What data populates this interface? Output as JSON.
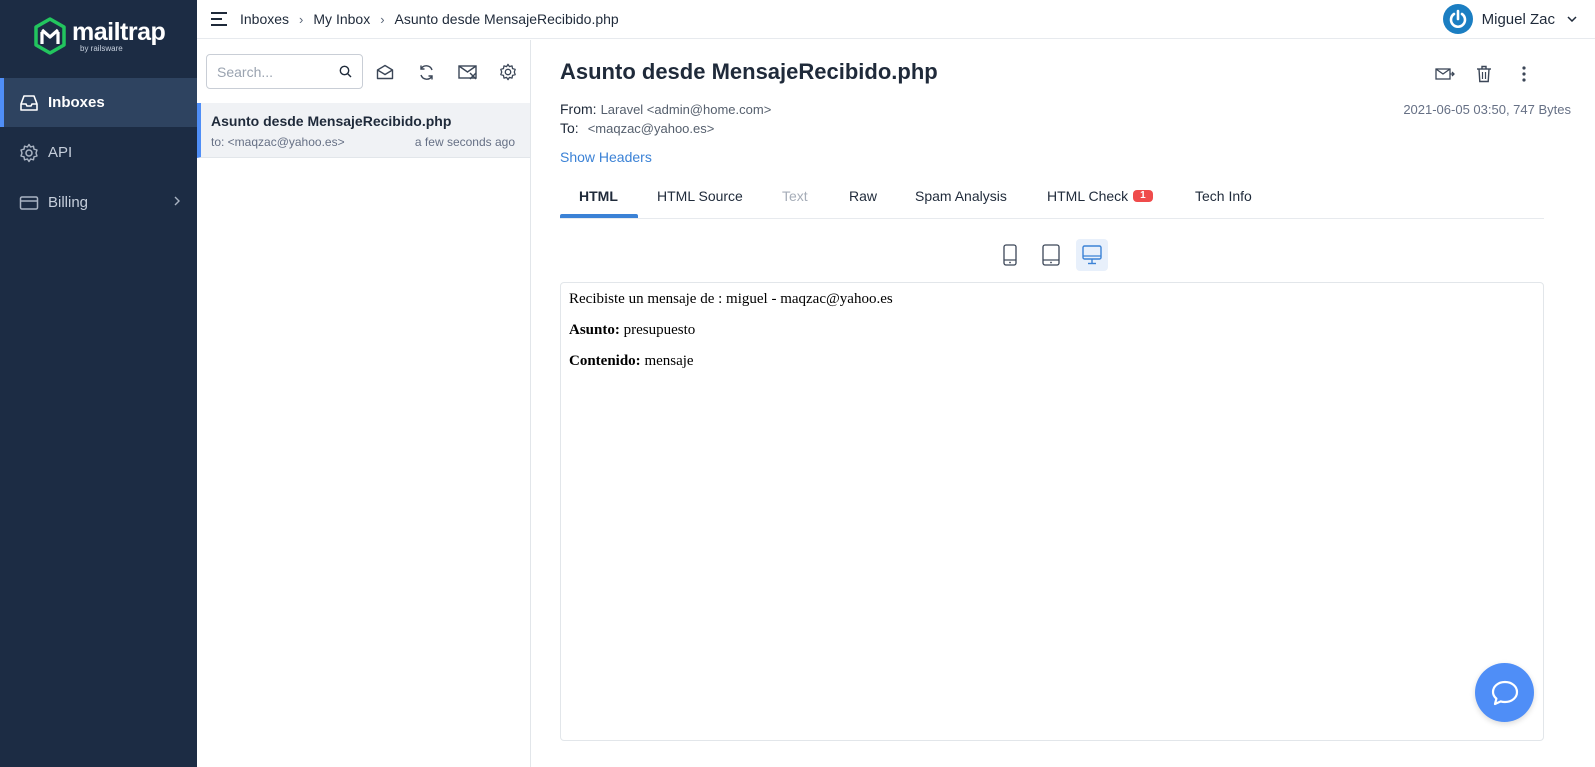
{
  "brand": {
    "name": "mailtrap",
    "sub": "by railsware"
  },
  "sidebar": {
    "items": [
      {
        "label": "Inboxes",
        "icon": "inbox-icon"
      },
      {
        "label": "API",
        "icon": "gear-icon"
      },
      {
        "label": "Billing",
        "icon": "card-icon"
      }
    ]
  },
  "breadcrumb": [
    "Inboxes",
    "My Inbox",
    "Asunto desde MensajeRecibido.php"
  ],
  "breadcrumb_sep": "›",
  "user": {
    "name": "Miguel Zac"
  },
  "search": {
    "placeholder": "Search..."
  },
  "messages": [
    {
      "subject": "Asunto desde MensajeRecibido.php",
      "to": "to: <maqzac@yahoo.es>",
      "time": "a few seconds ago"
    }
  ],
  "email": {
    "subject": "Asunto desde MensajeRecibido.php",
    "from_label": "From:",
    "from_value": "Laravel <admin@home.com>",
    "to_label": "To:",
    "to_value": "<maqzac@yahoo.es>",
    "date_size": "2021-06-05 03:50, 747 Bytes",
    "show_headers": "Show Headers"
  },
  "tabs": [
    {
      "label": "HTML",
      "state": "active"
    },
    {
      "label": "HTML Source",
      "state": "normal"
    },
    {
      "label": "Text",
      "state": "disabled"
    },
    {
      "label": "Raw",
      "state": "normal"
    },
    {
      "label": "Spam Analysis",
      "state": "normal"
    },
    {
      "label": "HTML Check",
      "state": "normal",
      "badge": "1"
    },
    {
      "label": "Tech Info",
      "state": "normal"
    }
  ],
  "preview": {
    "line1": "Recibiste un mensaje de : miguel - maqzac@yahoo.es",
    "asunto_label": "Asunto:",
    "asunto_value": "presupuesto",
    "contenido_label": "Contenido:",
    "contenido_value": "mensaje"
  },
  "colors": {
    "sidebar_bg": "#1c2c44",
    "accent": "#4f8ef7",
    "link": "#3b82d6",
    "badge": "#ef4b4b",
    "brand_green": "#22c55e"
  }
}
